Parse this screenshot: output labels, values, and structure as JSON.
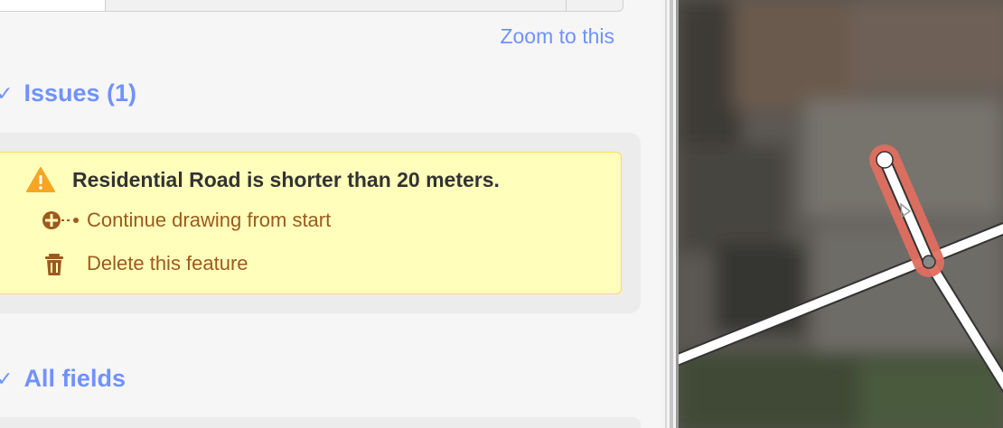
{
  "zoom_link": "Zoom to this",
  "issues_section": {
    "check": "✓",
    "title": "Issues (1)"
  },
  "issue": {
    "icon": "warning-triangle-icon",
    "message": "Residential Road is shorter than 20 meters.",
    "fixes": [
      {
        "icon": "continue-line-icon",
        "label": "Continue drawing from start"
      },
      {
        "icon": "trash-icon",
        "label": "Delete this feature"
      }
    ]
  },
  "fields_section": {
    "check": "✓",
    "title": "All fields"
  },
  "colors": {
    "link": "#7092ff",
    "warning_bg": "#ffffbb",
    "warning_border": "#ffd966",
    "fix_text": "#9d5a1e",
    "selected_way": "#e06e5f"
  }
}
